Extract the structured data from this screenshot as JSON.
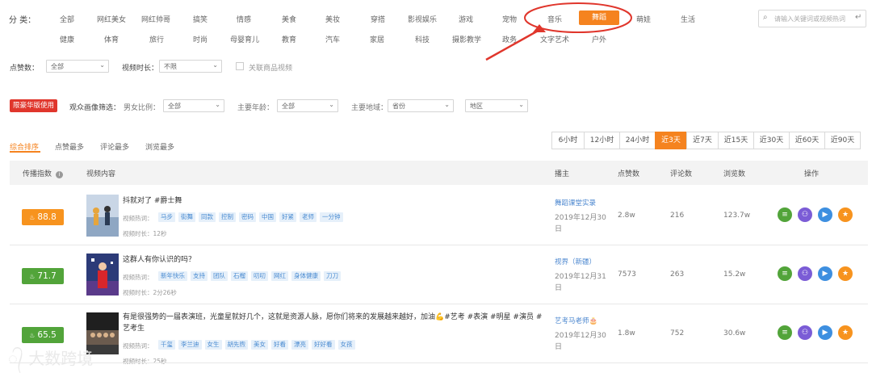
{
  "category": {
    "label": "分  类：",
    "row1": [
      "全部",
      "网红美女",
      "网红帅哥",
      "搞笑",
      "情感",
      "美食",
      "美妆",
      "穿搭",
      "影视娱乐",
      "游戏",
      "宠物",
      "音乐",
      "舞蹈",
      "萌娃",
      "生活"
    ],
    "row2": [
      "健康",
      "体育",
      "旅行",
      "时尚",
      "母婴育儿",
      "教育",
      "汽车",
      "家居",
      "科技",
      "摄影教学",
      "政务",
      "文字艺术",
      "户外"
    ],
    "active": "舞蹈",
    "search_placeholder": "请输入关键词或视频热词"
  },
  "filters": {
    "likes_label": "点赞数：",
    "likes_value": "全部",
    "duration_label": "视频时长：",
    "duration_value": "不限",
    "related_label": "关联商品视频",
    "limit_badge": "限豪华版使用",
    "audience_label": "观众画像筛选：",
    "gender_label": "男女比例：",
    "gender_value": "全部",
    "age_label": "主要年龄：",
    "age_value": "全部",
    "region_label": "主要地域：",
    "province_value": "省份",
    "district_value": "地区"
  },
  "sort_tabs": [
    "综合排序",
    "点赞最多",
    "评论最多",
    "浏览最多"
  ],
  "time_tabs": [
    "6小时",
    "12小时",
    "24小时",
    "近3天",
    "近7天",
    "近15天",
    "近30天",
    "近60天",
    "近90天"
  ],
  "table": {
    "headers": {
      "index": "传播指数",
      "content": "视频内容",
      "author": "播主",
      "likes": "点赞数",
      "comments": "评论数",
      "views": "浏览数",
      "actions": "操作"
    },
    "hot_label": "视频热词：",
    "duration_prefix": "视频时长：",
    "rows": [
      {
        "score": "88.8",
        "score_color": "#f7931e",
        "title": "抖就对了 #爵士舞",
        "tags": [
          "马步",
          "街舞",
          "同款",
          "控制",
          "密码",
          "中国",
          "好紧",
          "老师",
          "一分钟"
        ],
        "duration": "12秒",
        "author": "舞蹈课堂实录",
        "date": "2019年12月30日",
        "likes": "2.8w",
        "comments": "216",
        "views": "123.7w"
      },
      {
        "score": "71.7",
        "score_color": "#52a43a",
        "title": "这群人有你认识的吗？",
        "tags": [
          "新年快乐",
          "支持",
          "团队",
          "石榴",
          "叨叨",
          "网红",
          "身体健康",
          "刀刀"
        ],
        "duration": "2分26秒",
        "author": "视界（新疆）",
        "date": "2019年12月31日",
        "likes": "7573",
        "comments": "263",
        "views": "15.2w"
      },
      {
        "score": "65.5",
        "score_color": "#52a43a",
        "title": "有是很强势的一届表演班，光童星就好几个，这就是资源人脉，愿你们将来的发展越来越好，加油💪#艺考 #表演 #明星 #演员 #艺考生",
        "tags": [
          "千玺",
          "李兰迪",
          "女生",
          "胡先煦",
          "美女",
          "好看",
          "漂亮",
          "好好看",
          "女孩"
        ],
        "duration": "25秒",
        "author": "艺考马老师🎂",
        "date": "2019年12月30日",
        "likes": "1.8w",
        "comments": "752",
        "views": "30.6w"
      }
    ],
    "action_icons": [
      {
        "name": "list-icon",
        "color": "#52a43a",
        "glyph": "≡"
      },
      {
        "name": "users-icon",
        "color": "#7b5cd6",
        "glyph": "⚇"
      },
      {
        "name": "play-icon",
        "color": "#3d8fe0",
        "glyph": "▶"
      },
      {
        "name": "star-icon",
        "color": "#f7931e",
        "glyph": "★"
      }
    ]
  },
  "watermark": "大数跨境"
}
